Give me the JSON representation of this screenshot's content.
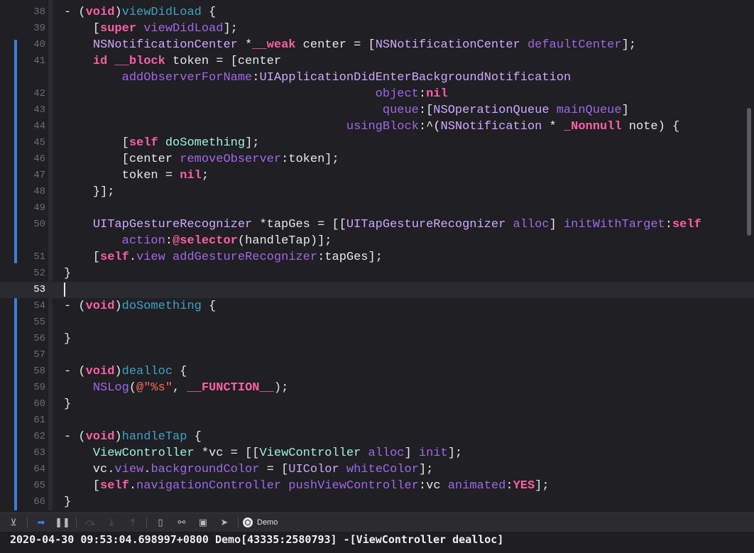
{
  "editor": {
    "current_line": "53",
    "lines": [
      {
        "num": "38",
        "tokens": [
          [
            "plain",
            "- ("
          ],
          [
            "kw",
            "void"
          ],
          [
            "plain",
            ")"
          ],
          [
            "decl",
            "viewDidLoad"
          ],
          [
            "plain",
            " {"
          ]
        ]
      },
      {
        "num": "39",
        "tokens": [
          [
            "plain",
            "    ["
          ],
          [
            "kw",
            "super"
          ],
          [
            "plain",
            " "
          ],
          [
            "meth",
            "viewDidLoad"
          ],
          [
            "plain",
            "];"
          ]
        ]
      },
      {
        "num": "40",
        "tokens": [
          [
            "plain",
            "    "
          ],
          [
            "cls",
            "NSNotificationCenter"
          ],
          [
            "plain",
            " *"
          ],
          [
            "kw",
            "__weak"
          ],
          [
            "plain",
            " center = ["
          ],
          [
            "cls",
            "NSNotificationCenter"
          ],
          [
            "plain",
            " "
          ],
          [
            "meth",
            "defaultCenter"
          ],
          [
            "plain",
            "];"
          ]
        ]
      },
      {
        "num": "41",
        "tokens": [
          [
            "plain",
            "    "
          ],
          [
            "kw",
            "id"
          ],
          [
            "plain",
            " "
          ],
          [
            "kw",
            "__block"
          ],
          [
            "plain",
            " token = [center"
          ]
        ]
      },
      {
        "num": "",
        "tokens": [
          [
            "plain",
            "        "
          ],
          [
            "meth",
            "addObserverForName"
          ],
          [
            "plain",
            ":"
          ],
          [
            "cls",
            "UIApplicationDidEnterBackgroundNotification"
          ]
        ]
      },
      {
        "num": "42",
        "tokens": [
          [
            "plain",
            "                                           "
          ],
          [
            "meth",
            "object"
          ],
          [
            "plain",
            ":"
          ],
          [
            "kw",
            "nil"
          ]
        ]
      },
      {
        "num": "43",
        "tokens": [
          [
            "plain",
            "                                            "
          ],
          [
            "meth",
            "queue"
          ],
          [
            "plain",
            ":["
          ],
          [
            "cls",
            "NSOperationQueue"
          ],
          [
            "plain",
            " "
          ],
          [
            "meth",
            "mainQueue"
          ],
          [
            "plain",
            "]"
          ]
        ]
      },
      {
        "num": "44",
        "tokens": [
          [
            "plain",
            "                                       "
          ],
          [
            "meth",
            "usingBlock"
          ],
          [
            "plain",
            ":^("
          ],
          [
            "cls",
            "NSNotification"
          ],
          [
            "plain",
            " * "
          ],
          [
            "kw",
            "_Nonnull"
          ],
          [
            "plain",
            " note) {"
          ]
        ]
      },
      {
        "num": "45",
        "tokens": [
          [
            "plain",
            "        ["
          ],
          [
            "kw",
            "self"
          ],
          [
            "plain",
            " "
          ],
          [
            "proj",
            "doSomething"
          ],
          [
            "plain",
            "];"
          ]
        ]
      },
      {
        "num": "46",
        "tokens": [
          [
            "plain",
            "        [center "
          ],
          [
            "meth",
            "removeObserver"
          ],
          [
            "plain",
            ":token];"
          ]
        ]
      },
      {
        "num": "47",
        "tokens": [
          [
            "plain",
            "        token = "
          ],
          [
            "kw",
            "nil"
          ],
          [
            "plain",
            ";"
          ]
        ]
      },
      {
        "num": "48",
        "tokens": [
          [
            "plain",
            "    }];"
          ]
        ]
      },
      {
        "num": "49",
        "tokens": []
      },
      {
        "num": "50",
        "tokens": [
          [
            "plain",
            "    "
          ],
          [
            "cls",
            "UITapGestureRecognizer"
          ],
          [
            "plain",
            " *tapGes = [["
          ],
          [
            "cls",
            "UITapGestureRecognizer"
          ],
          [
            "plain",
            " "
          ],
          [
            "meth",
            "alloc"
          ],
          [
            "plain",
            "] "
          ],
          [
            "meth",
            "initWithTarget"
          ],
          [
            "plain",
            ":"
          ],
          [
            "kw",
            "self"
          ]
        ]
      },
      {
        "num": "",
        "tokens": [
          [
            "plain",
            "        "
          ],
          [
            "meth",
            "action"
          ],
          [
            "plain",
            ":"
          ],
          [
            "kw",
            "@selector"
          ],
          [
            "plain",
            "(handleTap)];"
          ]
        ]
      },
      {
        "num": "51",
        "tokens": [
          [
            "plain",
            "    ["
          ],
          [
            "kw",
            "self"
          ],
          [
            "plain",
            "."
          ],
          [
            "meth",
            "view"
          ],
          [
            "plain",
            " "
          ],
          [
            "meth",
            "addGestureRecognizer"
          ],
          [
            "plain",
            ":tapGes];"
          ]
        ]
      },
      {
        "num": "52",
        "tokens": [
          [
            "plain",
            "}"
          ]
        ]
      },
      {
        "num": "53",
        "tokens": []
      },
      {
        "num": "54",
        "tokens": [
          [
            "plain",
            "- ("
          ],
          [
            "kw",
            "void"
          ],
          [
            "plain",
            ")"
          ],
          [
            "decl",
            "doSomething"
          ],
          [
            "plain",
            " {"
          ]
        ]
      },
      {
        "num": "55",
        "tokens": []
      },
      {
        "num": "56",
        "tokens": [
          [
            "plain",
            "}"
          ]
        ]
      },
      {
        "num": "57",
        "tokens": []
      },
      {
        "num": "58",
        "tokens": [
          [
            "plain",
            "- ("
          ],
          [
            "kw",
            "void"
          ],
          [
            "plain",
            ")"
          ],
          [
            "decl",
            "dealloc"
          ],
          [
            "plain",
            " {"
          ]
        ]
      },
      {
        "num": "59",
        "tokens": [
          [
            "plain",
            "    "
          ],
          [
            "meth",
            "NSLog"
          ],
          [
            "plain",
            "("
          ],
          [
            "str",
            "@\"%s\""
          ],
          [
            "plain",
            ", "
          ],
          [
            "kw",
            "__FUNCTION__"
          ],
          [
            "plain",
            ");"
          ]
        ]
      },
      {
        "num": "60",
        "tokens": [
          [
            "plain",
            "}"
          ]
        ]
      },
      {
        "num": "61",
        "tokens": []
      },
      {
        "num": "62",
        "tokens": [
          [
            "plain",
            "- ("
          ],
          [
            "kw",
            "void"
          ],
          [
            "plain",
            ")"
          ],
          [
            "decl",
            "handleTap"
          ],
          [
            "plain",
            " {"
          ]
        ]
      },
      {
        "num": "63",
        "tokens": [
          [
            "plain",
            "    "
          ],
          [
            "proj",
            "ViewController"
          ],
          [
            "plain",
            " *vc = [["
          ],
          [
            "proj",
            "ViewController"
          ],
          [
            "plain",
            " "
          ],
          [
            "meth",
            "alloc"
          ],
          [
            "plain",
            "] "
          ],
          [
            "meth",
            "init"
          ],
          [
            "plain",
            "];"
          ]
        ]
      },
      {
        "num": "64",
        "tokens": [
          [
            "plain",
            "    vc."
          ],
          [
            "meth",
            "view"
          ],
          [
            "plain",
            "."
          ],
          [
            "meth",
            "backgroundColor"
          ],
          [
            "plain",
            " = ["
          ],
          [
            "cls",
            "UIColor"
          ],
          [
            "plain",
            " "
          ],
          [
            "meth",
            "whiteColor"
          ],
          [
            "plain",
            "];"
          ]
        ]
      },
      {
        "num": "65",
        "tokens": [
          [
            "plain",
            "    ["
          ],
          [
            "kw",
            "self"
          ],
          [
            "plain",
            "."
          ],
          [
            "meth",
            "navigationController"
          ],
          [
            "plain",
            " "
          ],
          [
            "meth",
            "pushViewController"
          ],
          [
            "plain",
            ":vc "
          ],
          [
            "meth",
            "animated"
          ],
          [
            "plain",
            ":"
          ],
          [
            "kw",
            "YES"
          ],
          [
            "plain",
            "];"
          ]
        ]
      },
      {
        "num": "66",
        "tokens": [
          [
            "plain",
            "}"
          ]
        ]
      }
    ]
  },
  "debug_bar": {
    "buttons": [
      {
        "icon": "hide-debug-area-icon",
        "glyph": "⊻",
        "state": "normal"
      },
      {
        "icon": "breakpoints-toggle-icon",
        "glyph": "➡",
        "state": "active"
      },
      {
        "icon": "pause-icon",
        "glyph": "❚❚",
        "state": "normal"
      },
      {
        "icon": "step-over-icon",
        "glyph": "⤼",
        "state": "dim"
      },
      {
        "icon": "step-into-icon",
        "glyph": "⤓",
        "state": "dim"
      },
      {
        "icon": "step-out-icon",
        "glyph": "⤒",
        "state": "dim"
      },
      {
        "icon": "view-hierarchy-icon",
        "glyph": "▯",
        "state": "normal"
      },
      {
        "icon": "memory-graph-icon",
        "glyph": "⚯",
        "state": "normal"
      },
      {
        "icon": "environment-overrides-icon",
        "glyph": "▣",
        "state": "normal"
      },
      {
        "icon": "simulate-location-icon",
        "glyph": "➤",
        "state": "normal"
      }
    ],
    "scheme_label": "Demo"
  },
  "console": {
    "output": "2020-04-30 09:53:04.698997+0800 Demo[43335:2580793] -[ViewController dealloc]"
  }
}
